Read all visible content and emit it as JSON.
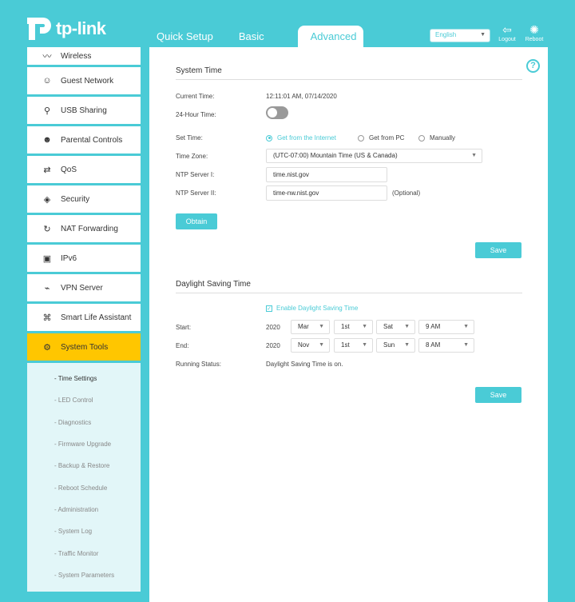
{
  "header": {
    "brand": "tp-link",
    "tabs": [
      {
        "label": "Quick Setup"
      },
      {
        "label": "Basic"
      },
      {
        "label": "Advanced"
      }
    ],
    "language": "English",
    "logout_label": "Logout",
    "reboot_label": "Reboot"
  },
  "sidebar": {
    "items": [
      {
        "label": "Wireless",
        "icon": "wifi-icon"
      },
      {
        "label": "Guest Network",
        "icon": "users-icon"
      },
      {
        "label": "USB Sharing",
        "icon": "usb-icon"
      },
      {
        "label": "Parental Controls",
        "icon": "family-icon"
      },
      {
        "label": "QoS",
        "icon": "qos-icon"
      },
      {
        "label": "Security",
        "icon": "shield-icon"
      },
      {
        "label": "NAT Forwarding",
        "icon": "nat-icon"
      },
      {
        "label": "IPv6",
        "icon": "ipv6-icon"
      },
      {
        "label": "VPN Server",
        "icon": "vpn-icon"
      },
      {
        "label": "Smart Life Assistant",
        "icon": "smart-life-icon"
      },
      {
        "label": "System Tools",
        "icon": "gear-icon"
      }
    ],
    "submenu": [
      "- Time Settings",
      "- LED Control",
      "- Diagnostics",
      "- Firmware Upgrade",
      "- Backup & Restore",
      "- Reboot Schedule",
      "- Administration",
      "- System Log",
      "- Traffic Monitor",
      "- System Parameters"
    ]
  },
  "system_time": {
    "title": "System Time",
    "current_time_label": "Current Time:",
    "current_time_value": "12:11:01 AM, 07/14/2020",
    "hour24_label": "24-Hour Time:",
    "set_time_label": "Set Time:",
    "options": [
      "Get from the Internet",
      "Get from PC",
      "Manually"
    ],
    "time_zone_label": "Time Zone:",
    "time_zone_value": "(UTC-07:00) Mountain Time (US & Canada)",
    "ntp1_label": "NTP Server I:",
    "ntp1_value": "time.nist.gov",
    "ntp2_label": "NTP Server II:",
    "ntp2_value": "time-nw.nist.gov",
    "ntp2_hint": "(Optional)",
    "obtain_label": "Obtain",
    "save_label": "Save"
  },
  "dst": {
    "title": "Daylight Saving Time",
    "enable_label": "Enable Daylight Saving Time",
    "start_label": "Start:",
    "start": {
      "year": "2020",
      "month": "Mar",
      "week": "1st",
      "day": "Sat",
      "time": "9 AM"
    },
    "end_label": "End:",
    "end": {
      "year": "2020",
      "month": "Nov",
      "week": "1st",
      "day": "Sun",
      "time": "8 AM"
    },
    "running_label": "Running Status:",
    "running_value": "Daylight Saving Time is on.",
    "save_label": "Save"
  },
  "colors": {
    "accent": "#4acbd6",
    "active": "#ffc600"
  }
}
